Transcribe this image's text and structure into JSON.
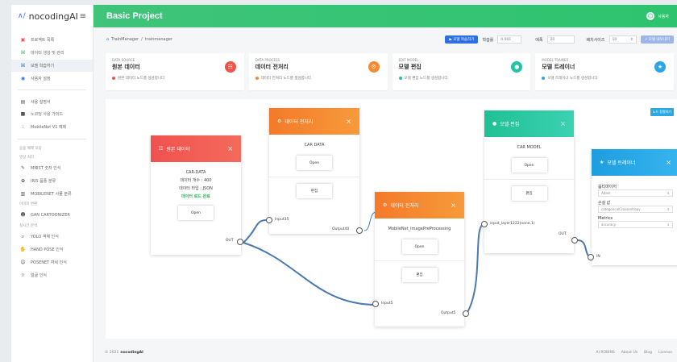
{
  "app": {
    "name": "nocodingAI",
    "logo_mark": "∧/",
    "menu_icon": "≡"
  },
  "header": {
    "title": "Basic Project",
    "user_name": "사용자",
    "avatar_glyph": "☺"
  },
  "sidebar": {
    "items": [
      {
        "icon": "▣",
        "label": "프로젝트 목록",
        "active": false,
        "color": "#e55353"
      },
      {
        "icon": "⌘",
        "label": "데이터 생성 및 관리",
        "active": false,
        "color": "#2eb85c"
      },
      {
        "icon": "⌘",
        "label": "모델 학습하기",
        "active": true,
        "color": "#2f6fe0"
      },
      {
        "icon": "◉",
        "label": "사용자 설정",
        "active": false,
        "color": "#2f6fe0"
      }
    ],
    "items2": [
      {
        "icon": "▤",
        "label": "사용 설명서"
      },
      {
        "icon": "■",
        "label": "노코딩 사용 가이드"
      },
      {
        "icon": "∴",
        "label": "MobileNet V1 예제"
      }
    ],
    "section1": "응용 예제 모음",
    "section1_sub": "영상 처리",
    "items3": [
      {
        "icon": "✎",
        "label": "MNIST 숫자 인식"
      },
      {
        "icon": "✿",
        "label": "IRIS 품종 분류"
      },
      {
        "icon": "▥",
        "label": "MOBILENET 사물 분류"
      }
    ],
    "section2": "이미지 변환",
    "items4": [
      {
        "icon": "☻",
        "label": "GAN CARTOONIZER"
      }
    ],
    "section3": "실시간 분석",
    "items5": [
      {
        "icon": "⌕",
        "label": "YOLO 객체 인식"
      },
      {
        "icon": "✋",
        "label": "HAND POSE 인식"
      },
      {
        "icon": "☺",
        "label": "POSENET 자세 인식"
      },
      {
        "icon": "☼",
        "label": "얼굴 인식"
      }
    ]
  },
  "toolbar": {
    "home_icon": "⌂",
    "crumb1": "TrainManager",
    "crumb_sep": "/",
    "crumb2": "trainmanager",
    "run_button": "▶ 모델 학습하기",
    "lr_label": "학습률",
    "lr_value": "0.001",
    "epoch_label": "에폭",
    "epoch_value": "20",
    "batch_label": "배치사이즈",
    "batch_value": "10",
    "save_button": "↗ 모델 내보내기"
  },
  "cards": [
    {
      "small": "DATA SOURCE",
      "title": "원본 데이터",
      "desc": "원본 데이터 노드를 생성합니다",
      "color": "#f0534a",
      "dot": "#f0534a",
      "icon": "☷"
    },
    {
      "small": "DATA PROCESS",
      "title": "데이터 전처리",
      "desc": "데이터 전처리 노드를 생성합니다",
      "color": "#f7892f",
      "dot": "#f7892f",
      "icon": "⚙"
    },
    {
      "small": "EDIT MODEL",
      "title": "모델 편집",
      "desc": "모델 편집 노드를 생성합니다",
      "color": "#21c4a0",
      "dot": "#21c4a0",
      "icon": "●"
    },
    {
      "small": "MODEL TRAINER",
      "title": "모델 트레이너",
      "desc": "모델 트레이너 노드를 생성합니다",
      "color": "#2aa6e6",
      "dot": "#2aa6e6",
      "icon": "★"
    }
  ],
  "canvas": {
    "float_button": "노드 정렬하기",
    "node_source": {
      "title": "원본 데이터",
      "line1": "CAR-DATA",
      "line2": "데이터 개수 : 400",
      "line3": "데이터 타입 : JSON",
      "line4": "데이터 로드 완료",
      "open": "Open",
      "out": "OUT"
    },
    "node_prep1": {
      "title": "데이터 전처리",
      "line1": "CAR DATA",
      "open": "Open",
      "edit": "편집",
      "in": "Input35",
      "out": "Output40"
    },
    "node_prep2": {
      "title": "데이터 전처리",
      "line1": "MobileNet_ImagePreProcessing",
      "open": "Open",
      "edit": "편집",
      "in": "Input5",
      "out": "Output5"
    },
    "node_model": {
      "title": "모델 편집",
      "line1": "CAR MODEL",
      "open": "Open",
      "edit": "편집",
      "in": "input_layer1222(none,1)",
      "out": "OUT"
    },
    "node_trainer": {
      "title": "모델 트레이너",
      "f1": "옵티마이저",
      "v1": "Adam",
      "f2": "손실 값",
      "v2": "categoricalCrossentropy",
      "f3": "Metrics",
      "v3": "accuracy",
      "in": "IN"
    }
  },
  "footer": {
    "copy": "© 2021",
    "brand": "nocodingAI",
    "links": [
      "AI ROBINS",
      "About Us",
      "Blog",
      "License"
    ]
  }
}
